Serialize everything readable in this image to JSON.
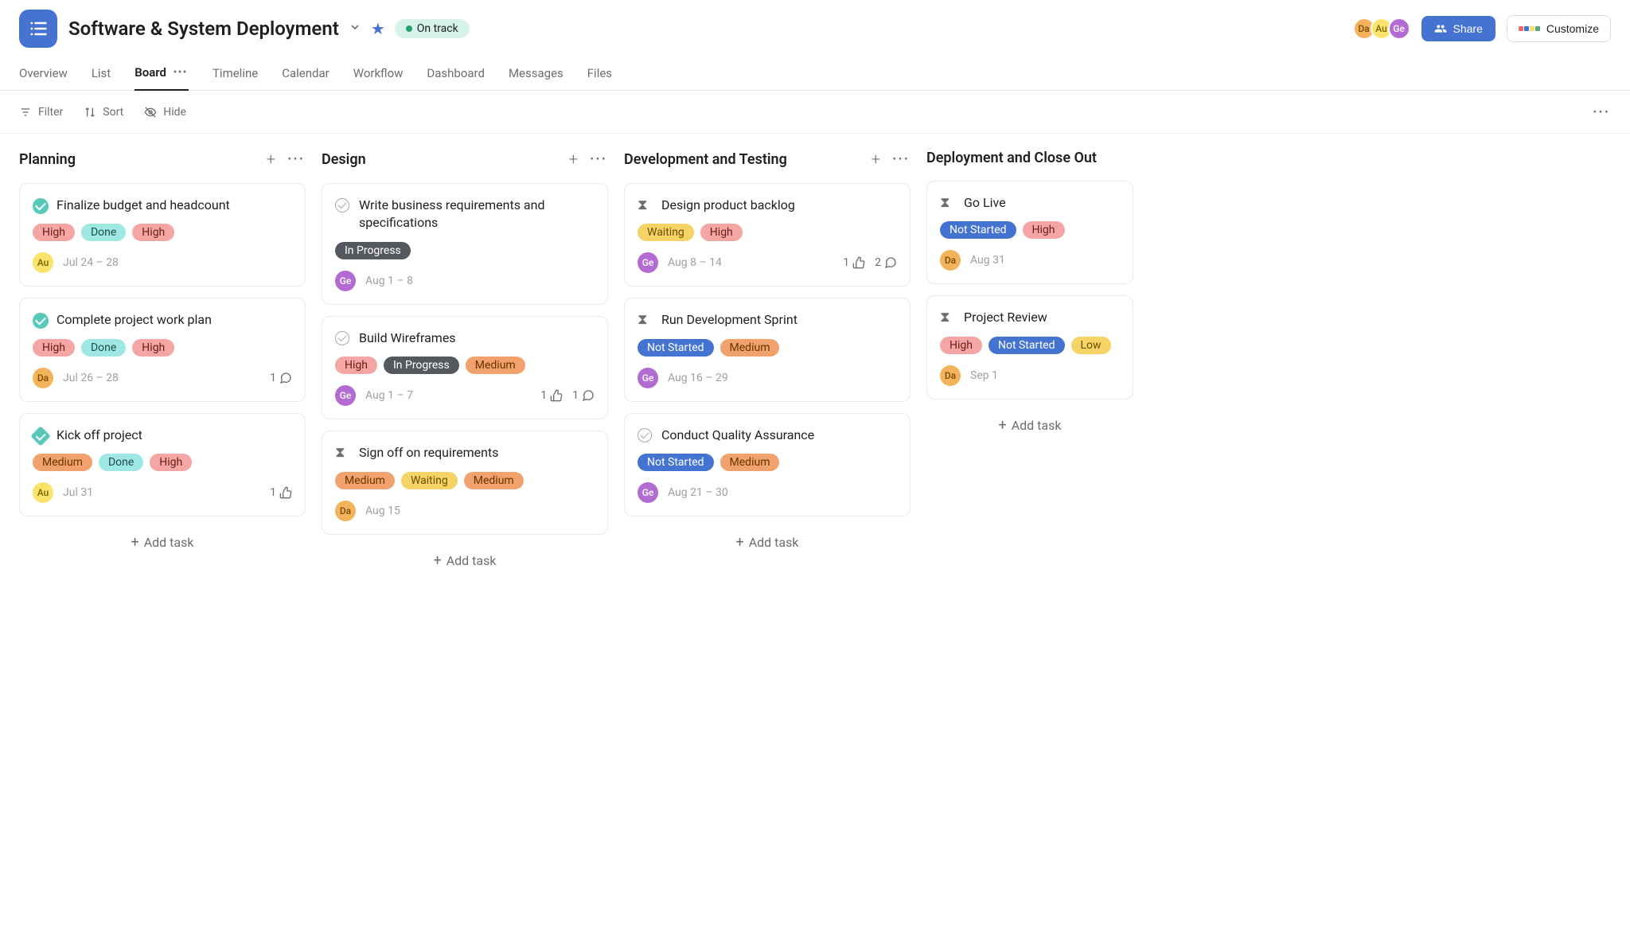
{
  "header": {
    "title": "Software & System Deployment",
    "status_label": "On track",
    "share_label": "Share",
    "customize_label": "Customize",
    "members": [
      {
        "initials": "Da",
        "cls": "avatar-da"
      },
      {
        "initials": "Au",
        "cls": "avatar-au"
      },
      {
        "initials": "Ge",
        "cls": "avatar-ge"
      }
    ]
  },
  "tabs": [
    {
      "label": "Overview",
      "active": false
    },
    {
      "label": "List",
      "active": false
    },
    {
      "label": "Board",
      "active": true,
      "more": true
    },
    {
      "label": "Timeline",
      "active": false
    },
    {
      "label": "Calendar",
      "active": false
    },
    {
      "label": "Workflow",
      "active": false
    },
    {
      "label": "Dashboard",
      "active": false
    },
    {
      "label": "Messages",
      "active": false
    },
    {
      "label": "Files",
      "active": false
    }
  ],
  "toolbar": {
    "filter": "Filter",
    "sort": "Sort",
    "hide": "Hide"
  },
  "add_task_label": "Add task",
  "columns": [
    {
      "title": "Planning",
      "show_actions": true,
      "cards": [
        {
          "icon": "circle-done",
          "title": "Finalize budget and headcount",
          "tags": [
            {
              "text": "High",
              "cls": "tag-red"
            },
            {
              "text": "Done",
              "cls": "tag-teal"
            },
            {
              "text": "High",
              "cls": "tag-red"
            }
          ],
          "assignee": {
            "initials": "Au",
            "cls": "avatar-au"
          },
          "date": "Jul 24 – 28"
        },
        {
          "icon": "circle-done",
          "title": "Complete project work plan",
          "tags": [
            {
              "text": "High",
              "cls": "tag-red"
            },
            {
              "text": "Done",
              "cls": "tag-teal"
            },
            {
              "text": "High",
              "cls": "tag-red"
            }
          ],
          "assignee": {
            "initials": "Da",
            "cls": "avatar-da"
          },
          "date": "Jul 26 – 28",
          "comments": 1
        },
        {
          "icon": "milestone-done",
          "title": "Kick off project",
          "tags": [
            {
              "text": "Medium",
              "cls": "tag-orange"
            },
            {
              "text": "Done",
              "cls": "tag-teal"
            },
            {
              "text": "High",
              "cls": "tag-red"
            }
          ],
          "assignee": {
            "initials": "Au",
            "cls": "avatar-au"
          },
          "date": "Jul 31",
          "likes": 1
        }
      ]
    },
    {
      "title": "Design",
      "show_actions": true,
      "cards": [
        {
          "icon": "circle-open",
          "title": "Write business requirements and specifications",
          "tags": [
            {
              "text": "In Progress",
              "cls": "tag-gray"
            }
          ],
          "assignee": {
            "initials": "Ge",
            "cls": "avatar-ge"
          },
          "date": "Aug 1 – 8"
        },
        {
          "icon": "circle-open",
          "title": "Build Wireframes",
          "tags": [
            {
              "text": "High",
              "cls": "tag-red"
            },
            {
              "text": "In Progress",
              "cls": "tag-gray"
            },
            {
              "text": "Medium",
              "cls": "tag-orange"
            }
          ],
          "assignee": {
            "initials": "Ge",
            "cls": "avatar-ge"
          },
          "date": "Aug 1 – 7",
          "likes": 1,
          "comments": 1
        },
        {
          "icon": "hourglass",
          "title": "Sign off on requirements",
          "tags": [
            {
              "text": "Medium",
              "cls": "tag-orange"
            },
            {
              "text": "Waiting",
              "cls": "tag-yellow"
            },
            {
              "text": "Medium",
              "cls": "tag-orange"
            }
          ],
          "assignee": {
            "initials": "Da",
            "cls": "avatar-da"
          },
          "date": "Aug 15"
        }
      ]
    },
    {
      "title": "Development and Testing",
      "show_actions": true,
      "cards": [
        {
          "icon": "hourglass",
          "title": "Design product backlog",
          "tags": [
            {
              "text": "Waiting",
              "cls": "tag-yellow"
            },
            {
              "text": "High",
              "cls": "tag-red"
            }
          ],
          "assignee": {
            "initials": "Ge",
            "cls": "avatar-ge"
          },
          "date": "Aug 8 – 14",
          "likes": 1,
          "comments": 2
        },
        {
          "icon": "hourglass",
          "title": "Run Development Sprint",
          "tags": [
            {
              "text": "Not Started",
              "cls": "tag-blue"
            },
            {
              "text": "Medium",
              "cls": "tag-orange"
            }
          ],
          "assignee": {
            "initials": "Ge",
            "cls": "avatar-ge"
          },
          "date": "Aug 16 – 29"
        },
        {
          "icon": "circle-open",
          "title": "Conduct Quality Assurance",
          "tags": [
            {
              "text": "Not Started",
              "cls": "tag-blue"
            },
            {
              "text": "Medium",
              "cls": "tag-orange"
            }
          ],
          "assignee": {
            "initials": "Ge",
            "cls": "avatar-ge"
          },
          "date": "Aug 21 – 30"
        }
      ]
    },
    {
      "title": "Deployment and Close Out",
      "show_actions": false,
      "cut": true,
      "cards": [
        {
          "icon": "hourglass",
          "title": "Go Live",
          "tags": [
            {
              "text": "Not Started",
              "cls": "tag-blue"
            },
            {
              "text": "High",
              "cls": "tag-red"
            }
          ],
          "assignee": {
            "initials": "Da",
            "cls": "avatar-da"
          },
          "date": "Aug 31"
        },
        {
          "icon": "hourglass",
          "title": "Project Review",
          "tags": [
            {
              "text": "High",
              "cls": "tag-red"
            },
            {
              "text": "Not Started",
              "cls": "tag-blue"
            },
            {
              "text": "Low",
              "cls": "tag-yellow"
            }
          ],
          "assignee": {
            "initials": "Da",
            "cls": "avatar-da"
          },
          "date": "Sep 1"
        }
      ]
    }
  ]
}
